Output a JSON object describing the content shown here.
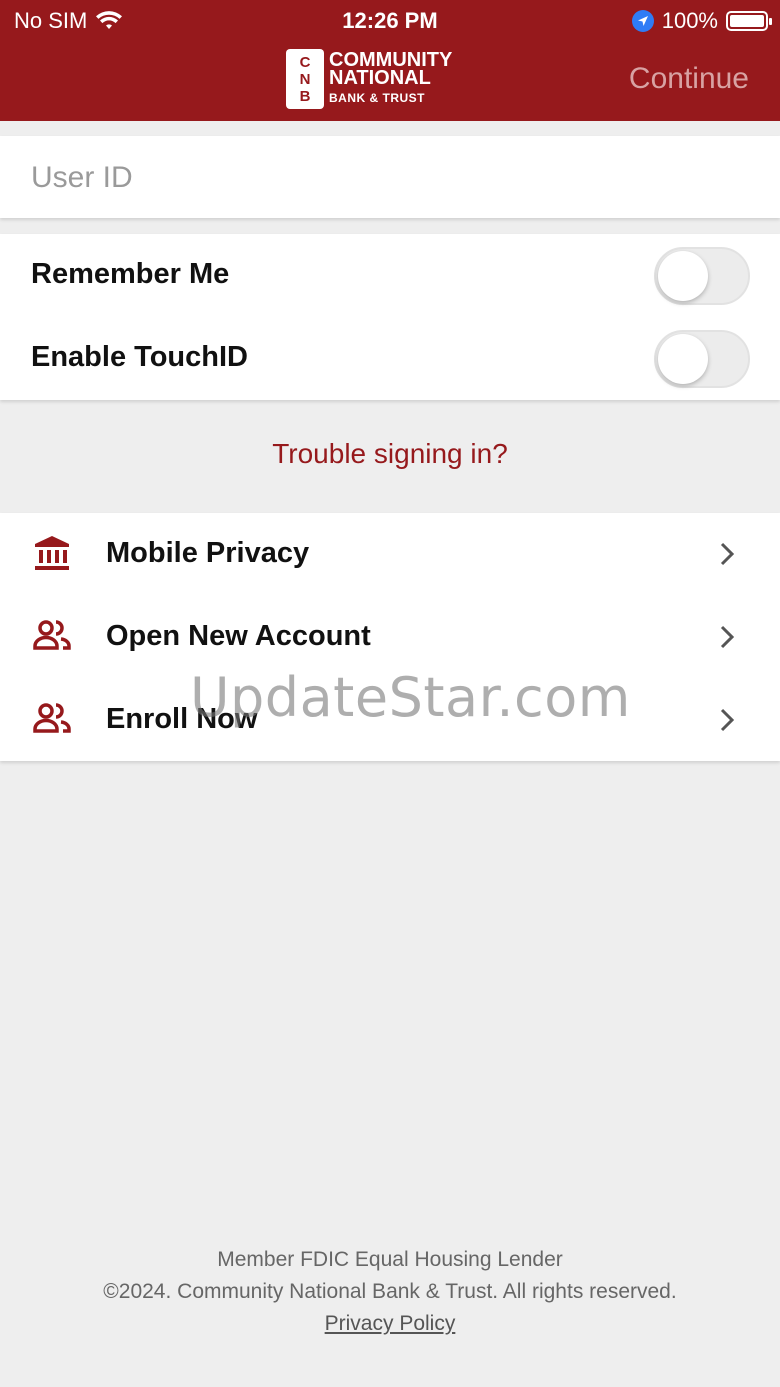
{
  "status_bar": {
    "carrier": "No SIM",
    "time": "12:26 PM",
    "battery": "100%",
    "battery_level": 1.0,
    "icons": [
      "wifi-icon",
      "location-icon",
      "battery-icon"
    ]
  },
  "header": {
    "logo": {
      "letters": [
        "C",
        "N",
        "B"
      ],
      "line1": "COMMUNITY",
      "line2": "NATIONAL",
      "line3": "BANK & TRUST"
    },
    "continue_label": "Continue"
  },
  "login": {
    "user_id_placeholder": "User ID",
    "user_id_value": ""
  },
  "toggles": [
    {
      "label": "Remember Me",
      "on": false
    },
    {
      "label": "Enable TouchID",
      "on": false
    }
  ],
  "trouble_link": "Trouble signing in?",
  "links": [
    {
      "label": "Mobile Privacy",
      "icon": "bank-icon"
    },
    {
      "label": "Open New Account",
      "icon": "people-icon"
    },
    {
      "label": "Enroll Now",
      "icon": "people-icon"
    }
  ],
  "watermark": "UpdateStar.com",
  "footer": {
    "line1": "Member FDIC Equal Housing Lender",
    "line2": "©2024. Community National Bank & Trust. All rights reserved.",
    "privacy_policy": "Privacy Policy"
  },
  "colors": {
    "brand": "#96191c",
    "background": "#eeeeee",
    "continue_disabled": "#d8a2a3"
  }
}
